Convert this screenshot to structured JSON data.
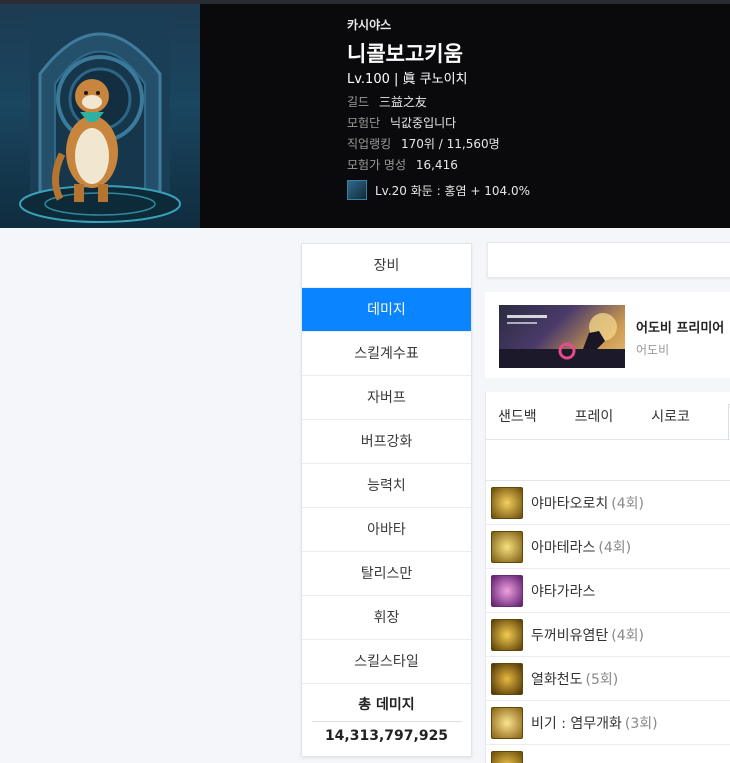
{
  "header": {
    "server": "카시야스",
    "name": "니콜보고키움",
    "level_line": "Lv.100 | 眞 쿠노이치",
    "guild": {
      "label": "길드",
      "value": "三益之友"
    },
    "adventure": {
      "label": "모험단",
      "value": "닉값중입니다"
    },
    "ranking": {
      "label": "직업랭킹",
      "value": "170위 / 11,560명"
    },
    "fame": {
      "label": "모험가 명성",
      "value": "16,416"
    },
    "union": {
      "text": "Lv.20 화둔 : 홍염 + 104.0%",
      "icon": "union-icon"
    }
  },
  "menu": {
    "items": [
      "장비",
      "데미지",
      "스킬계수표",
      "자버프",
      "버프강화",
      "능력치",
      "아바타",
      "탈리스만",
      "휘장",
      "스킬스타일"
    ],
    "active_index": 1,
    "total_label": "총 데미지",
    "total_value": "14,313,797,925"
  },
  "ad": {
    "title": "어도비 프리미어",
    "subtitle": "어도비"
  },
  "tabs": [
    "샌드백",
    "프레이",
    "시로코"
  ],
  "skills": [
    {
      "name": "야마타오로치",
      "count": "(4회)",
      "color": "#c89a1a"
    },
    {
      "name": "아마테라스",
      "count": "(4회)",
      "color": "#d4a020"
    },
    {
      "name": "야타가라스",
      "count": "",
      "color": "#b04ab0"
    },
    {
      "name": "두꺼비유염탄",
      "count": "(4회)",
      "color": "#caa020"
    },
    {
      "name": "열화천도",
      "count": "(5회)",
      "color": "#c08a10"
    },
    {
      "name": "비기 : 염무개화",
      "count": "(3회)",
      "color": "#d6a628"
    }
  ],
  "colors": {
    "accent": "#0a84ff",
    "header_bg": "#0a0a0c"
  }
}
